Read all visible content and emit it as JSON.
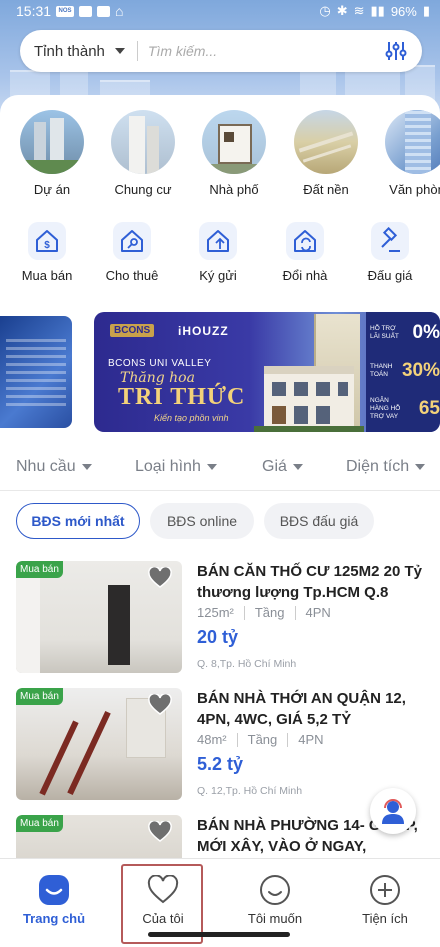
{
  "status_bar": {
    "time": "15:31",
    "battery": "96%",
    "carrier_badge": "NOS"
  },
  "search": {
    "province_label": "Tỉnh thành",
    "placeholder": "Tìm kiếm..."
  },
  "categories": [
    {
      "label": "Dự án"
    },
    {
      "label": "Chung cư"
    },
    {
      "label": "Nhà phố"
    },
    {
      "label": "Đất nền"
    },
    {
      "label": "Văn phòn"
    }
  ],
  "services": [
    {
      "label": "Mua bán",
      "icon": "house-dollar-icon"
    },
    {
      "label": "Cho thuê",
      "icon": "house-key-icon"
    },
    {
      "label": "Ký gửi",
      "icon": "house-upload-icon"
    },
    {
      "label": "Đổi nhà",
      "icon": "house-swap-icon"
    },
    {
      "label": "Đấu giá",
      "icon": "auction-gavel-icon"
    }
  ],
  "banner": {
    "brand_left": "BCONS",
    "brand_right": "iHOUZZ",
    "project": "BCONS UNI VALLEY",
    "slogan": "Thăng hoa",
    "headline": "TRI THỨC",
    "sub": "Kiến tạo phồn vinh",
    "offers": [
      {
        "text": "HỖ TRỢ LÃI SUẤT",
        "value": "0%"
      },
      {
        "text": "THANH TOÁN",
        "value": "30%"
      },
      {
        "text": "NGÂN HÀNG HỖ TRỢ VAY",
        "value": "65"
      }
    ]
  },
  "filters": [
    "Nhu cầu",
    "Loại hình",
    "Giá",
    "Diện tích"
  ],
  "tabs": {
    "active": "BĐS mới nhất",
    "second": "BĐS online",
    "third": "BĐS đấu giá"
  },
  "listings": [
    {
      "tag": "Mua bán",
      "title": "BÁN CĂN THỐ CƯ 125M2 20 Tỷ thương lượng Tp.HCM Q.8",
      "area": "125m²",
      "floor": "Tầng",
      "rooms": "4PN",
      "price": "20 tỷ",
      "location": "Q. 8,Tp. Hồ Chí Minh"
    },
    {
      "tag": "Mua bán",
      "title": "BÁN NHÀ THỚI AN QUẬN 12, 4PN, 4WC, GIÁ 5,2 TỶ",
      "area": "48m²",
      "floor": "Tầng",
      "rooms": "4PN",
      "price": "5.2 tỷ",
      "location": "Q. 12,Tp. Hồ Chí Minh"
    },
    {
      "tag": "Mua bán",
      "title": "BÁN NHÀ PHƯỜNG 14- G VẤP, MỚI XÂY, VÀO Ở NGAY,",
      "area": "",
      "floor": "",
      "rooms": "",
      "price": "",
      "location": ""
    }
  ],
  "nav": {
    "home": "Trang chủ",
    "mine": "Của tôi",
    "want": "Tôi muốn",
    "utilities": "Tiện ích"
  },
  "colors": {
    "accent": "#2f5fd6",
    "tag_green": "#3aa34a",
    "highlight_box": "#b55a5a"
  }
}
